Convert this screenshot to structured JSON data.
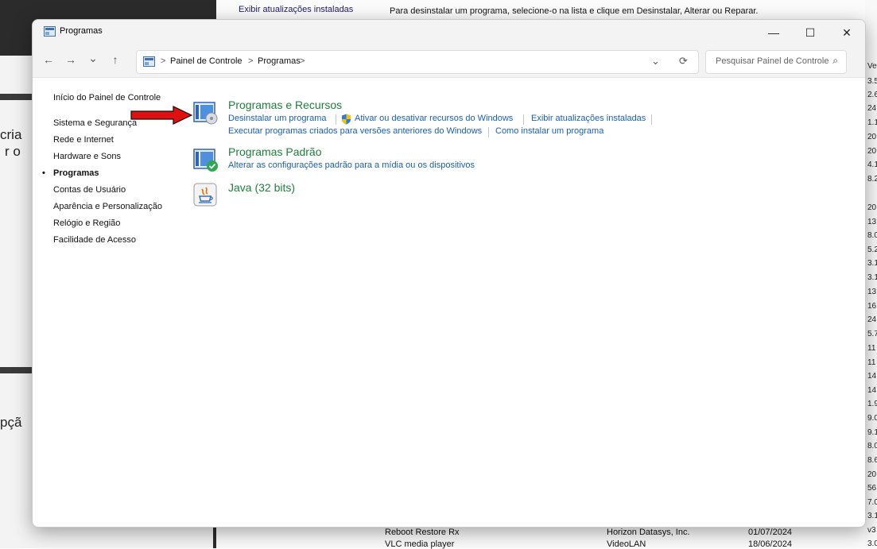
{
  "window": {
    "title": "Programas"
  },
  "address": {
    "crumbs": [
      "Painel de Controle",
      "Programas"
    ],
    "sep": ">"
  },
  "search": {
    "placeholder": "Pesquisar Painel de Controle"
  },
  "controls": {
    "minimize": "—",
    "maximize": "☐",
    "close": "✕"
  },
  "nav": {
    "back": "←",
    "forward": "→",
    "recent": "⌄",
    "up": "↑",
    "dropdown": "⌄",
    "refresh": "⟳",
    "search_icon": "⌕"
  },
  "sidebar": {
    "items": [
      {
        "label": "Início do Painel de Controle",
        "selected": false
      },
      {
        "label": "Sistema e Segurança",
        "selected": false
      },
      {
        "label": "Rede e Internet",
        "selected": false
      },
      {
        "label": "Hardware e Sons",
        "selected": false
      },
      {
        "label": "Programas",
        "selected": true
      },
      {
        "label": "Contas de Usuário",
        "selected": false
      },
      {
        "label": "Aparência e Personalização",
        "selected": false
      },
      {
        "label": "Relógio e Região",
        "selected": false
      },
      {
        "label": "Facilidade de Acesso",
        "selected": false
      }
    ],
    "bullet": "•"
  },
  "categories": [
    {
      "title": "Programas e Recursos",
      "links": [
        "Desinstalar um programa",
        "Ativar ou desativar recursos do Windows",
        "Exibir atualizações instaladas",
        "Executar programas criados para versões anteriores do Windows",
        "Como instalar um programa"
      ]
    },
    {
      "title": "Programas Padrão",
      "links": [
        "Alterar as configurações padrão para a mídia ou os dispositivos"
      ]
    },
    {
      "title": "Java (32 bits)",
      "links": []
    }
  ],
  "background": {
    "top_link": "Exibir atualizações instaladas",
    "top_hint": "Para desinstalar um programa, selecione-o na lista e clique em Desinstalar, Alterar ou Reparar.",
    "rows": [
      {
        "name": "Reboot Restore Rx",
        "publisher": "Horizon Datasys, Inc.",
        "date": "01/07/2024"
      },
      {
        "name": "VLC media player",
        "publisher": "VideoLAN",
        "date": "18/06/2024"
      }
    ],
    "left_fragments": [
      "cria",
      "r o",
      "pçã"
    ],
    "right_column": [
      "Ve",
      "3.5",
      "2.6",
      "24",
      "1.1",
      "20",
      "20",
      "4.1",
      "8.2",
      "20",
      "13",
      "8.0",
      "5.2",
      "3.1",
      "3.1",
      "13",
      "16",
      "24",
      "5.7",
      "11",
      "11",
      "14",
      "14",
      "1.9",
      "9.0",
      "9.1",
      "8.0",
      "8.6",
      "20",
      "56",
      "7.0",
      "3.1",
      "v3",
      "3.0"
    ]
  },
  "colors": {
    "accent_green": "#1e7f3c",
    "link_blue": "#1a5fb4",
    "arrow_red": "#e01010"
  }
}
